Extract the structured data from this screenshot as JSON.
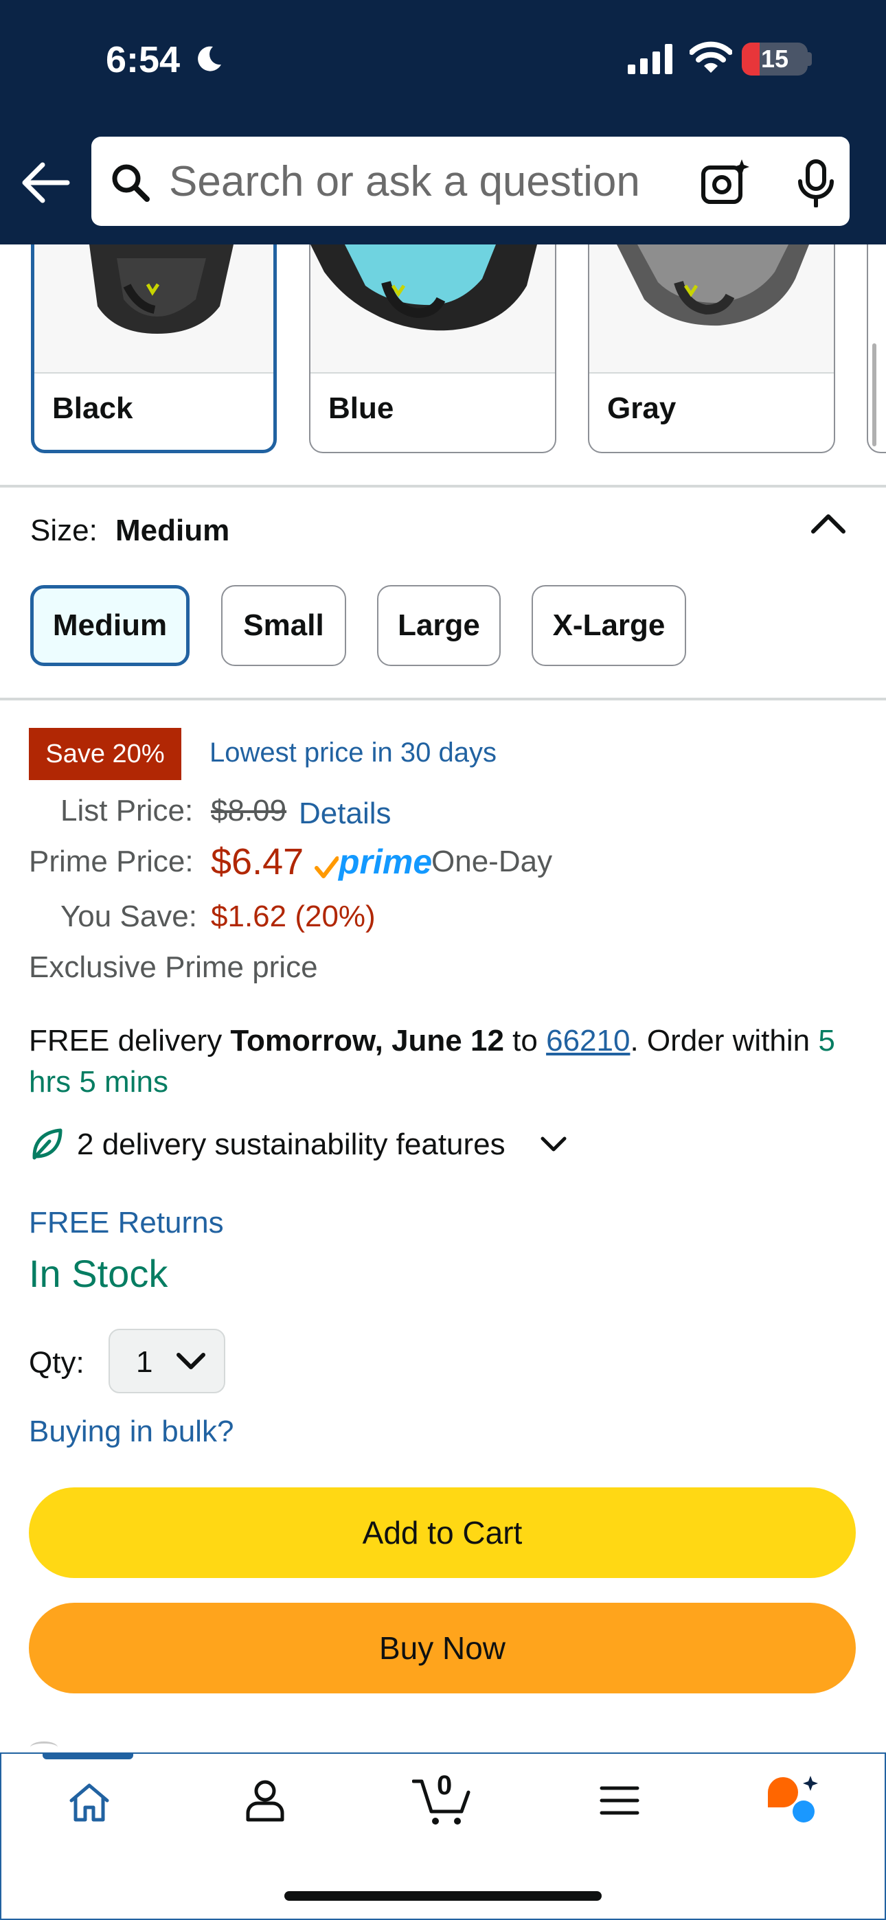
{
  "status_bar": {
    "time": "6:54",
    "battery": "15"
  },
  "search": {
    "placeholder": "Search or ask a question"
  },
  "colors": {
    "header_bg": "#0b2446",
    "link": "#2162a1",
    "price_red": "#b12704",
    "stock_green": "#067d62",
    "add_to_cart": "#ffd814",
    "buy_now": "#ffa41c",
    "prime_blue": "#1399ff"
  },
  "color_options": [
    {
      "label": "Black",
      "selected": true
    },
    {
      "label": "Blue",
      "selected": false
    },
    {
      "label": "Gray",
      "selected": false
    }
  ],
  "size": {
    "label": "Size:",
    "value": "Medium",
    "options": [
      {
        "label": "Medium",
        "selected": true
      },
      {
        "label": "Small",
        "selected": false
      },
      {
        "label": "Large",
        "selected": false
      },
      {
        "label": "X-Large",
        "selected": false
      }
    ]
  },
  "price": {
    "save_badge": "Save 20%",
    "lowest_price_link": "Lowest price in 30 days",
    "list_price_label": "List Price:",
    "list_price": "$8.09",
    "details_link": "Details",
    "prime_price_label": "Prime Price:",
    "prime_price": "$6.47",
    "prime_logo": "prime",
    "prime_delivery": "One-Day",
    "you_save_label": "You Save:",
    "you_save": "$1.62 (20%)",
    "exclusive": "Exclusive Prime price"
  },
  "delivery": {
    "prefix": "FREE delivery ",
    "date": "Tomorrow, June 12",
    "to": " to ",
    "zip": "66210",
    "order_within": ". Order within ",
    "countdown": "5 hrs 5 mins",
    "sustainability": "2 delivery sustainability features",
    "free_returns": "FREE Returns",
    "stock": "In Stock"
  },
  "quantity": {
    "label": "Qty:",
    "value": "1"
  },
  "bulk_link": "Buying in bulk?",
  "buttons": {
    "add_to_cart": "Add to Cart",
    "buy_now": "Buy Now"
  },
  "bottom_nav": {
    "items": [
      "home-icon",
      "account-icon",
      "cart-icon",
      "menu-icon",
      "rufus-icon"
    ],
    "cart_count": "0",
    "active": "home"
  }
}
